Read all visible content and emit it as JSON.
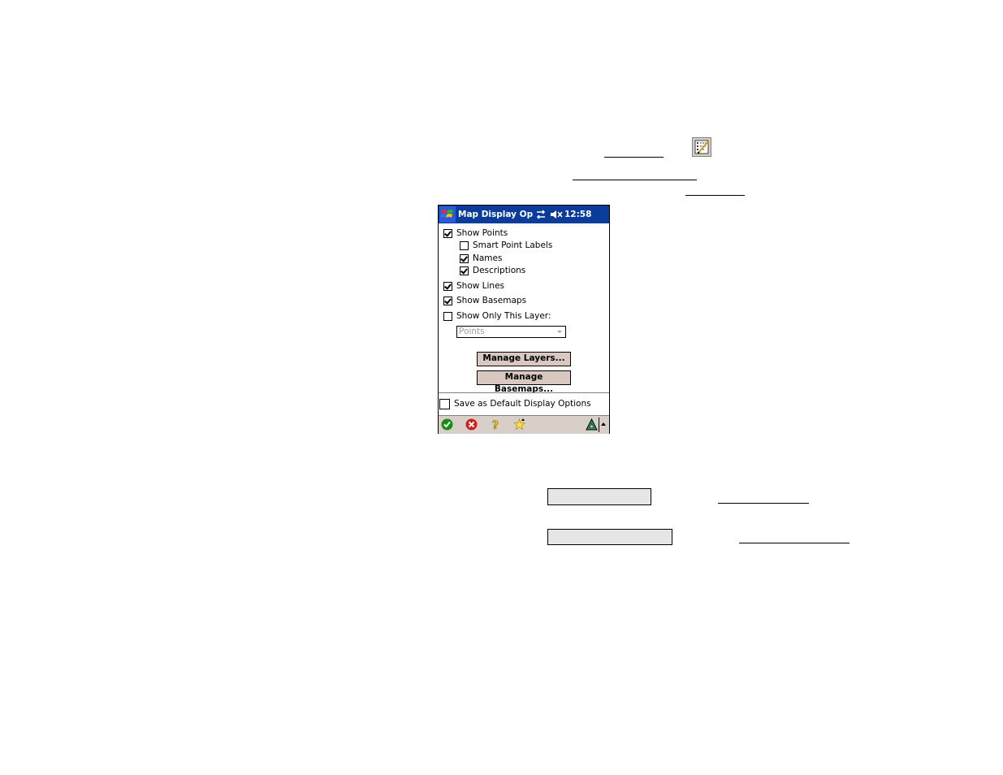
{
  "device": {
    "titlebar": {
      "title": "Map Display Optio",
      "clock": "12:58",
      "icons": [
        "windows-start-icon",
        "connectivity-icon",
        "speaker-muted-icon"
      ]
    },
    "options": {
      "show_points": {
        "label": "Show Points",
        "checked": true
      },
      "smart_point_labels": {
        "label": "Smart Point Labels",
        "checked": false
      },
      "names": {
        "label": "Names",
        "checked": true
      },
      "descriptions": {
        "label": "Descriptions",
        "checked": true
      },
      "show_lines": {
        "label": "Show Lines",
        "checked": true
      },
      "show_basemaps": {
        "label": "Show Basemaps",
        "checked": true
      },
      "show_only_this_layer": {
        "label": "Show Only This Layer:",
        "checked": false
      }
    },
    "layer_select": {
      "value": "Points",
      "disabled": true
    },
    "buttons": {
      "manage_layers": "Manage Layers...",
      "manage_basemaps": "Manage Basemaps..."
    },
    "save_default": {
      "label": "Save as Default Display Options",
      "checked": false
    },
    "toolbar": {
      "icons": [
        "ok-icon",
        "cancel-icon",
        "help-icon",
        "favorites-icon",
        "gps-status-icon",
        "sip-up-arrow-icon"
      ]
    }
  },
  "colors": {
    "titlebar": "#0b3c9c",
    "button_face": "#d8c8c0",
    "toolbar": "#d8d0c8",
    "doc_field": "#e6e6e6"
  }
}
